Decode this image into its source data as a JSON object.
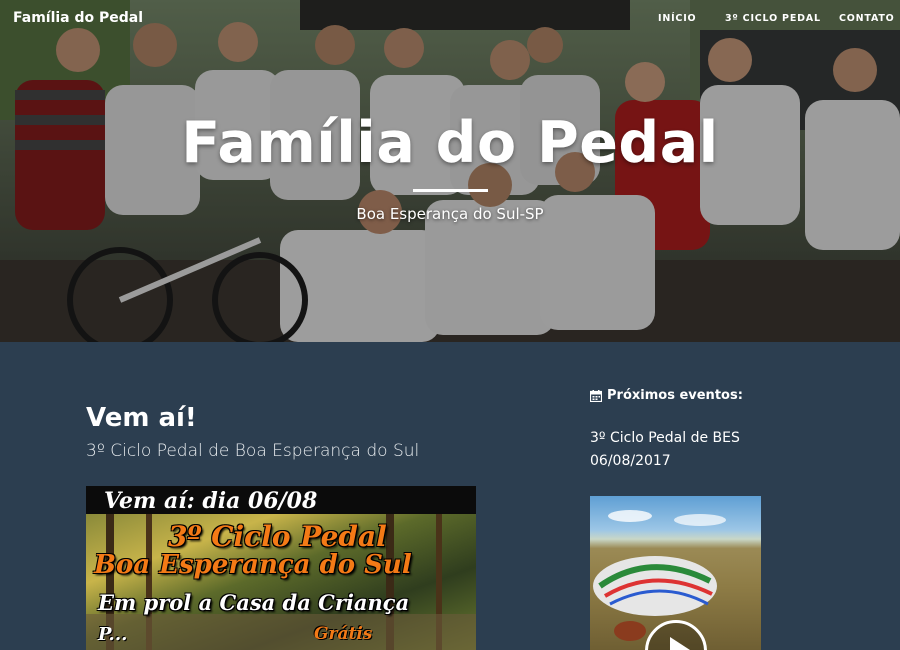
{
  "nav": {
    "brand": "Família do Pedal",
    "links": [
      "INÍCIO",
      "3º CICLO PEDAL",
      "CONTATO"
    ]
  },
  "hero": {
    "title": "Família do Pedal",
    "subtitle": "Boa Esperança do Sul-SP"
  },
  "post": {
    "title": "Vem aí!",
    "subtitle": "3º Ciclo Pedal de Boa Esperança do Sul",
    "poster": {
      "line1": "Vem aí: dia 06/08",
      "line2": "3º Ciclo Pedal",
      "line3": "Boa Esperança do Sul",
      "line4": "Em prol a Casa da Criança",
      "line5": "P...",
      "line6": "Grátis"
    }
  },
  "sidebar": {
    "heading": "Próximos eventos:",
    "heading_icon": "calendar-icon",
    "event": {
      "name": "3º Ciclo Pedal de BES",
      "date": "06/08/2017"
    },
    "video_icon": "play-icon"
  },
  "colors": {
    "background": "#2c3e50",
    "poster_accent": "#f47a16",
    "text": "#ffffff"
  }
}
